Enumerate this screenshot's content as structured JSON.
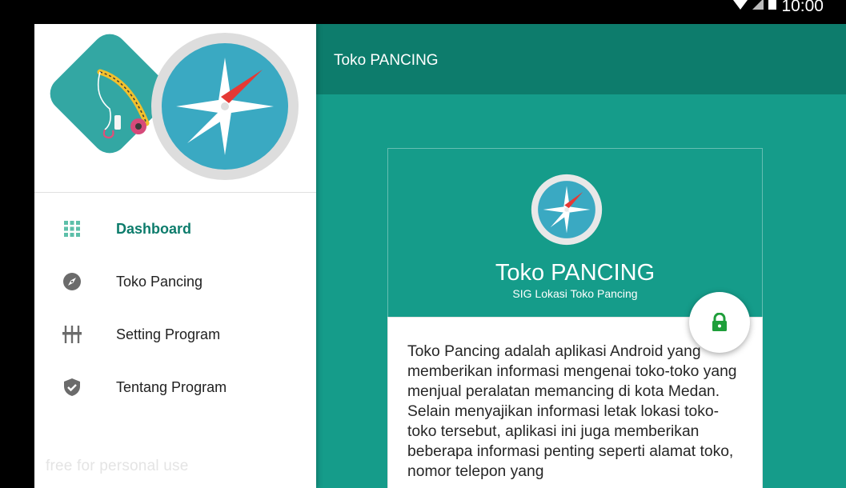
{
  "status_bar": {
    "time": "10:00",
    "icons": [
      "wifi-icon",
      "signal-icon",
      "battery-icon"
    ]
  },
  "toolbar": {
    "title": "Toko PANCING"
  },
  "drawer": {
    "menu": [
      {
        "label": "Dashboard",
        "icon": "dashboard-grid-icon",
        "active": true
      },
      {
        "label": "Toko Pancing",
        "icon": "compass-icon",
        "active": false
      },
      {
        "label": "Setting Program",
        "icon": "equalizer-icon",
        "active": false
      },
      {
        "label": "Tentang Program",
        "icon": "verified-shield-icon",
        "active": false
      }
    ],
    "watermark": "free for personal use"
  },
  "card": {
    "title": "Toko PANCING",
    "subtitle": "SIG Lokasi Toko Pancing",
    "body": "Toko Pancing adalah aplikasi Android yang memberikan informasi mengenai toko-toko yang menjual peralatan memancing di kota Medan. Selain menyajikan informasi letak lokasi toko-toko tersebut, aplikasi ini juga memberikan beberapa informasi penting seperti alamat toko, nomor telepon yang"
  },
  "fab": {
    "icon": "lock-icon"
  },
  "colors": {
    "primary": "#159c8a",
    "primary_dark": "#0d7c6c",
    "accent_red": "#e53935",
    "fab_icon": "#1e9e3a"
  }
}
